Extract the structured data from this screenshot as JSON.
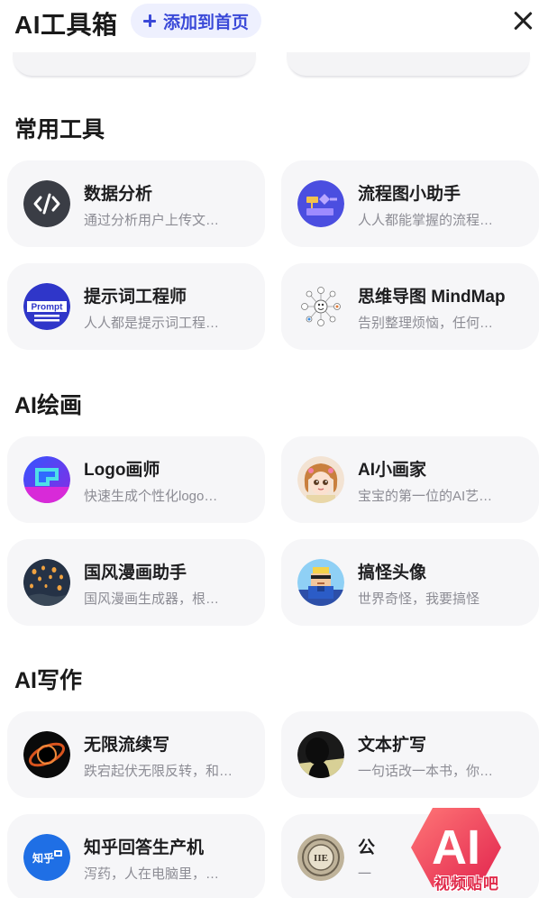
{
  "header": {
    "title": "AI工具箱",
    "add_home_label": "添加到首页"
  },
  "sections": [
    {
      "title": "常用工具",
      "cards": [
        {
          "name": "数据分析",
          "desc": "通过分析用户上传文…",
          "icon": "code-icon"
        },
        {
          "name": "流程图小助手",
          "desc": "人人都能掌握的流程…",
          "icon": "flowchart-icon"
        },
        {
          "name": "提示词工程师",
          "desc": "人人都是提示词工程…",
          "icon": "prompt-icon",
          "icon_text": "Prompt"
        },
        {
          "name": "思维导图 MindMap",
          "desc": "告别整理烦恼，任何…",
          "icon": "mindmap-icon"
        }
      ]
    },
    {
      "title": "AI绘画",
      "cards": [
        {
          "name": "Logo画师",
          "desc": "快速生成个性化logo…",
          "icon": "logo-painter-icon"
        },
        {
          "name": "AI小画家",
          "desc": "宝宝的第一位的AI艺…",
          "icon": "little-painter-avatar"
        },
        {
          "name": "国风漫画助手",
          "desc": "国风漫画生成器，根…",
          "icon": "lantern-night-icon"
        },
        {
          "name": "搞怪头像",
          "desc": "世界奇怪，我要搞怪",
          "icon": "pixel-avatar-icon"
        }
      ]
    },
    {
      "title": "AI写作",
      "cards": [
        {
          "name": "无限流续写",
          "desc": "跌宕起伏无限反转，和…",
          "icon": "black-hole-icon"
        },
        {
          "name": "文本扩写",
          "desc": "一句话改一本书，你…",
          "icon": "silhouette-icon"
        },
        {
          "name": "知乎回答生产机",
          "desc": "泻药，人在电脑里，…",
          "icon": "zhihu-icon",
          "icon_text": "知乎"
        },
        {
          "name": "公",
          "desc": "一",
          "icon": "seal-icon",
          "icon_text": "IIE"
        }
      ]
    }
  ],
  "watermark": {
    "logo_text": "AI",
    "caption": "视频贴吧"
  },
  "colors": {
    "accent": "#3a49d8",
    "card_bg": "#f6f6f8",
    "watermark": "#e02a4a"
  }
}
